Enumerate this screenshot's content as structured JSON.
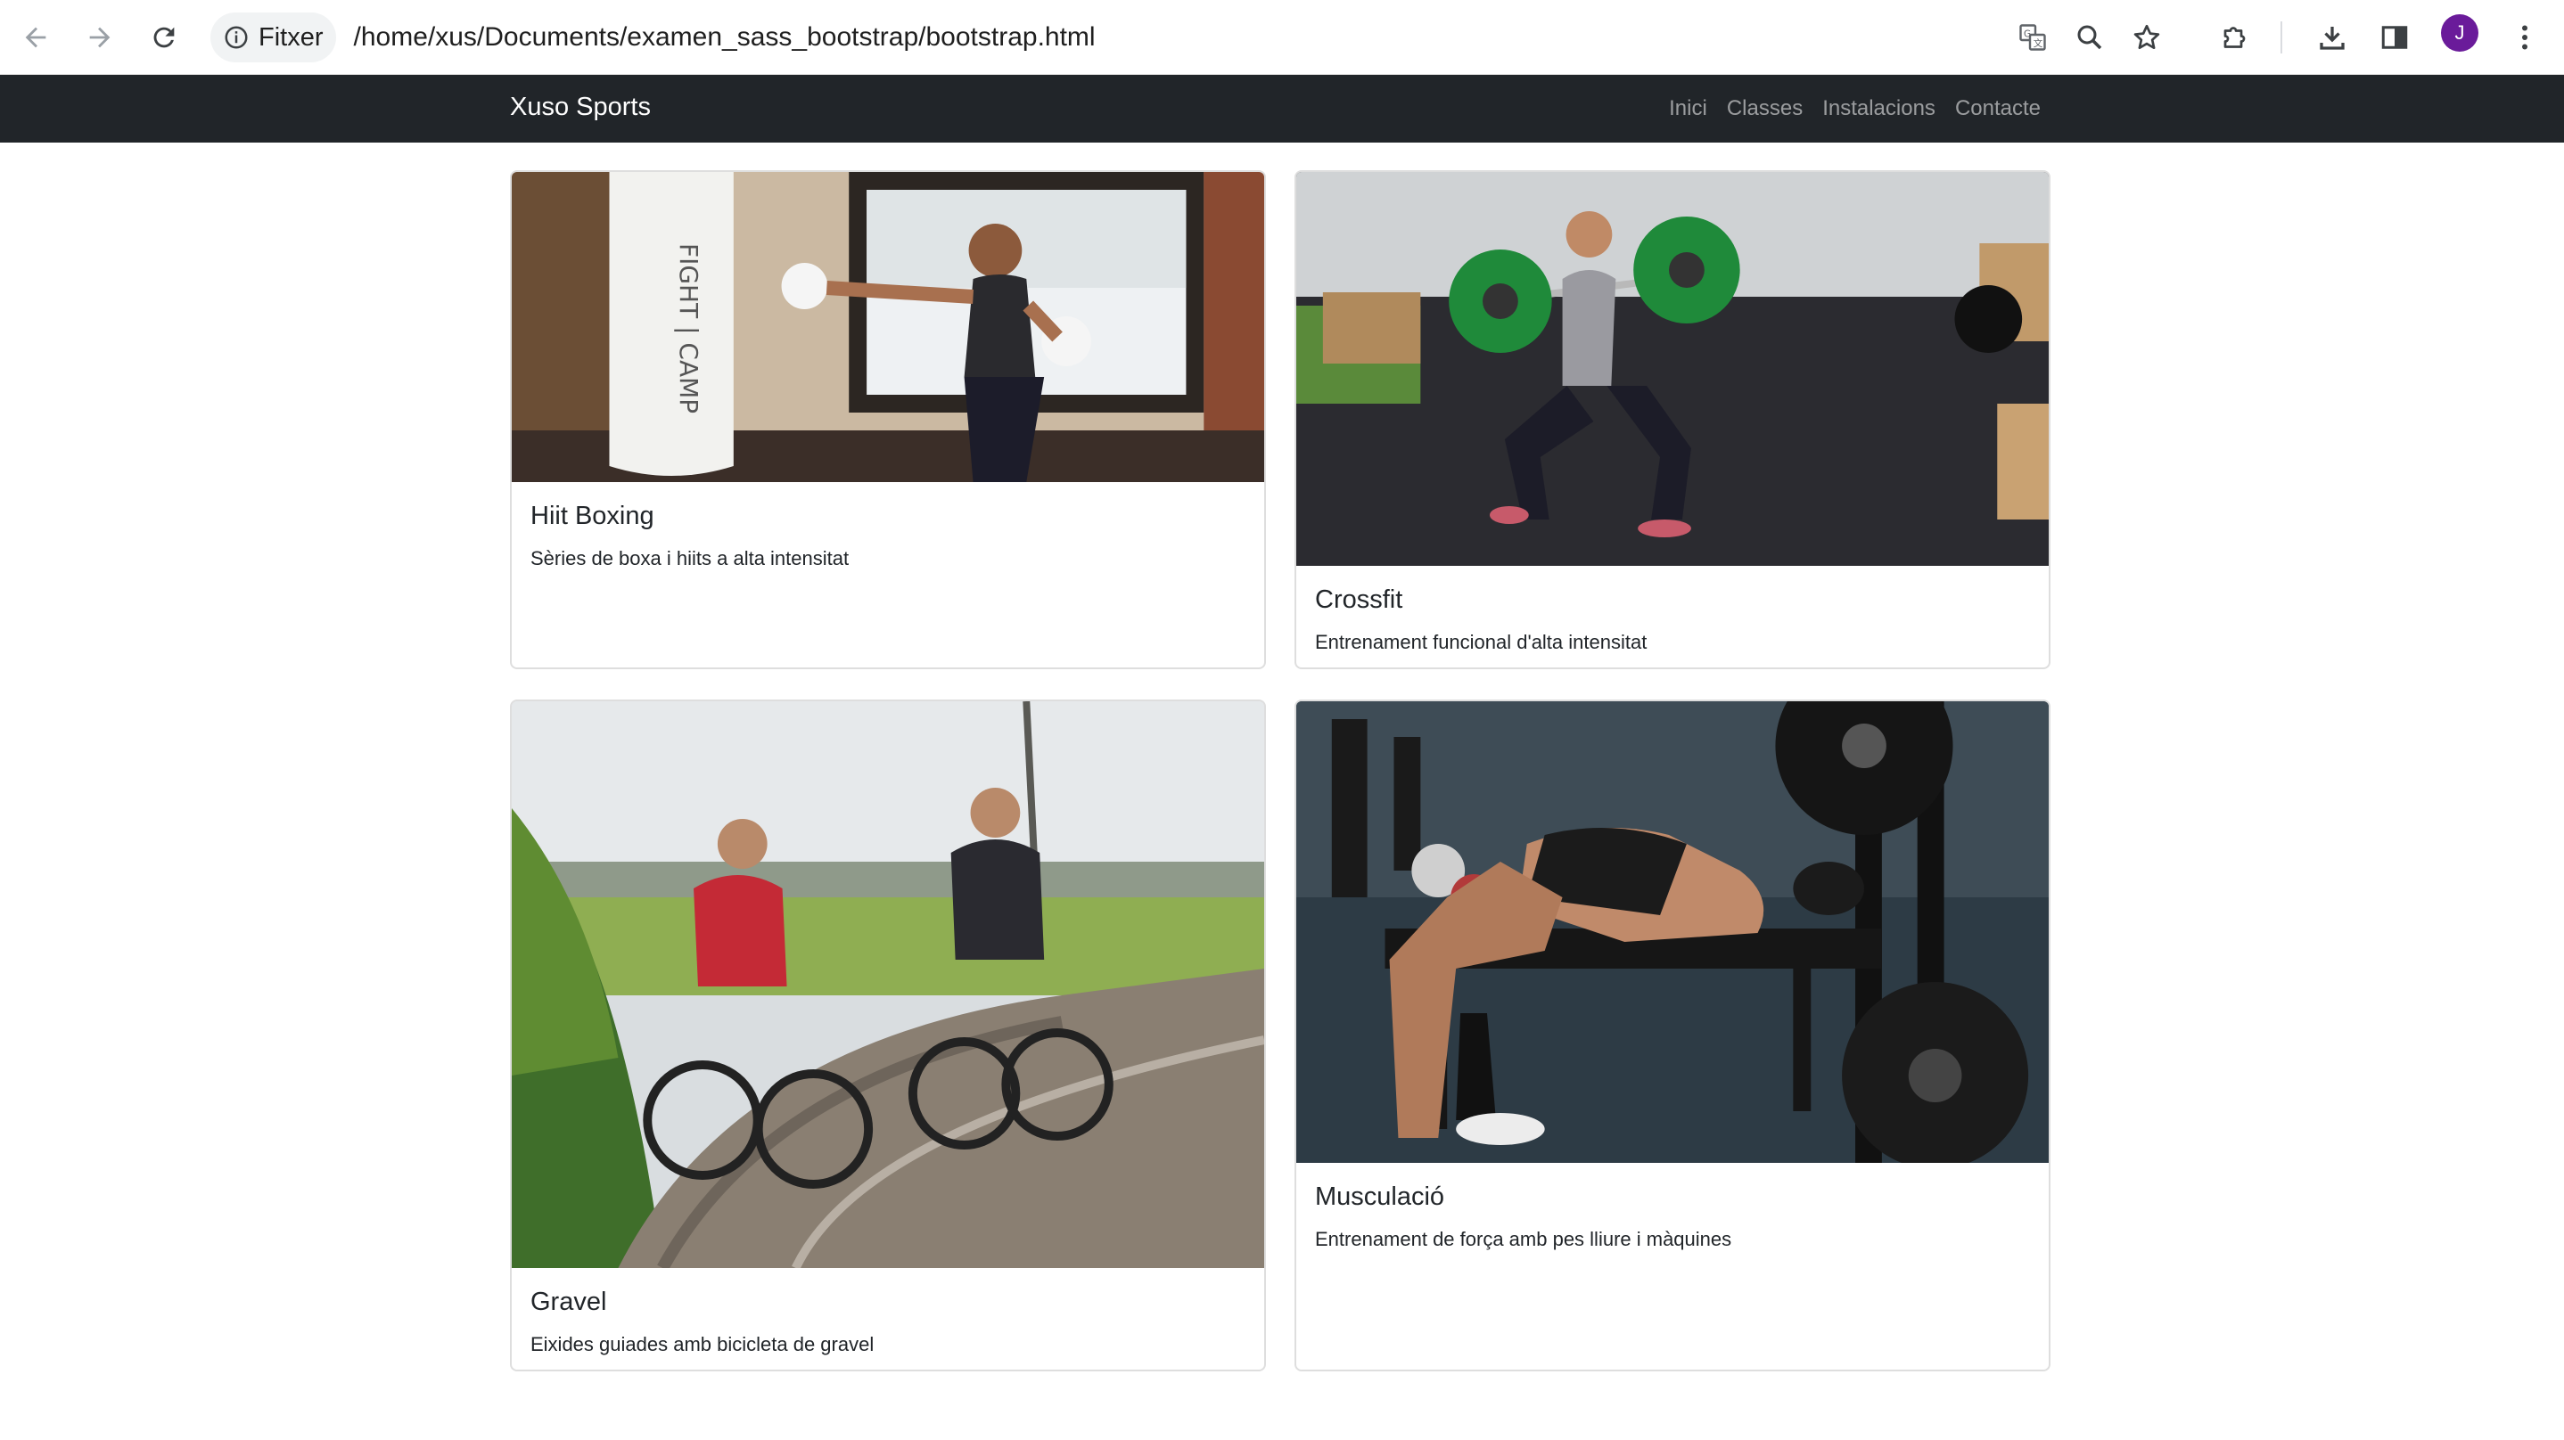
{
  "browser": {
    "site_info_label": "Fitxer",
    "url": "/home/xus/Documents/examen_sass_bootstrap/bootstrap.html",
    "profile_initial": "J",
    "profile_color": "#6a1b9a"
  },
  "navbar": {
    "brand": "Xuso Sports",
    "links": [
      "Inici",
      "Classes",
      "Instalacions",
      "Contacte"
    ],
    "background": "#212529"
  },
  "cards": [
    {
      "title": "Hiit Boxing",
      "text": "Sèries de boxa i hiits a alta intensitat",
      "image": "boxing-photo"
    },
    {
      "title": "Crossfit",
      "text": "Entrenament funcional d'alta intensitat",
      "image": "crossfit-photo"
    },
    {
      "title": "Gravel",
      "text": "Eixides guiades amb bicicleta de gravel",
      "image": "gravel-photo"
    },
    {
      "title": "Musculació",
      "text": "Entrenament de força amb pes lliure i màquines",
      "image": "bench-press-photo"
    }
  ]
}
